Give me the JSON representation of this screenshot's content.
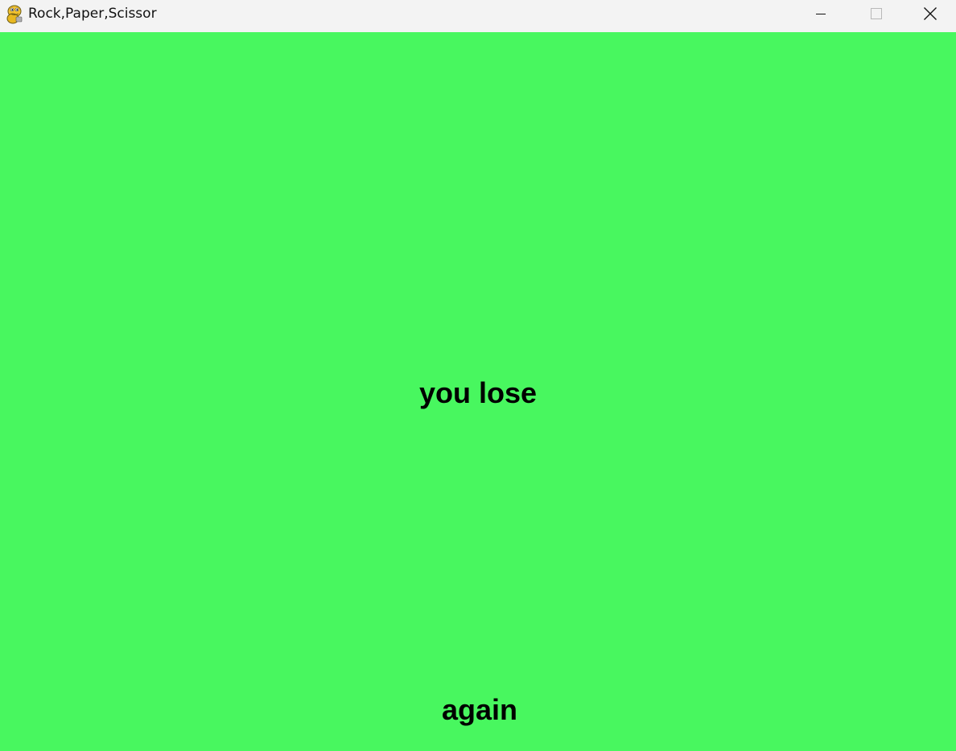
{
  "window": {
    "title": "Rock,Paper,Scissor",
    "app_icon": "pygame-snake-icon",
    "controls": {
      "minimize_icon": "minimize-icon",
      "maximize_icon": "maximize-icon",
      "close_icon": "close-icon"
    }
  },
  "game": {
    "background_color": "#48f75f",
    "result_text": "you lose",
    "again_label": "again",
    "text_color": "#000000"
  }
}
